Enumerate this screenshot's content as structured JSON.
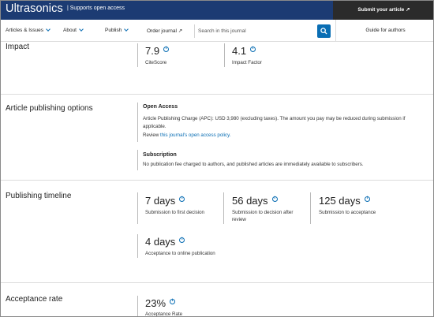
{
  "header": {
    "journal_name": "Ultrasonics",
    "open_access": "| Supports open access",
    "submit": "Submit your article ↗"
  },
  "nav": {
    "items": [
      {
        "label": "Articles & Issues"
      },
      {
        "label": "About"
      },
      {
        "label": "Publish"
      },
      {
        "label": "Order journal ↗"
      }
    ],
    "search_placeholder": "Search in this journal",
    "guide": "Guide for authors"
  },
  "impact": {
    "title": "Impact",
    "metrics": [
      {
        "value": "7.9",
        "label": "CiteScore"
      },
      {
        "value": "4.1",
        "label": "Impact Factor"
      }
    ]
  },
  "publishing_options": {
    "title": "Article publishing options",
    "open_access": {
      "heading": "Open Access",
      "line1": "Article Publishing Charge (APC): USD 3,980 (excluding taxes). The amount you pay may be reduced during submission if",
      "line2": "applicable.",
      "review_prefix": "Review ",
      "review_link": "this journal's open access policy."
    },
    "subscription": {
      "heading": "Subscription",
      "text": "No publication fee charged to authors, and published articles are immediately available to subscribers."
    }
  },
  "timeline": {
    "title": "Publishing timeline",
    "metrics": [
      {
        "value": "7 days",
        "label": "Submission to first decision"
      },
      {
        "value": "56 days",
        "label_line1": "Submission to decision after",
        "label_line2": "review"
      },
      {
        "value": "125 days",
        "label": "Submission to acceptance"
      },
      {
        "value": "4 days",
        "label": "Acceptance to online publication"
      }
    ]
  },
  "acceptance": {
    "title": "Acceptance rate",
    "value": "23%",
    "label": "Acceptance Rate"
  },
  "colors": {
    "header_bg": "#1c3b73",
    "submit_bg": "#2b2b2b",
    "accent": "#0a6eb4"
  }
}
